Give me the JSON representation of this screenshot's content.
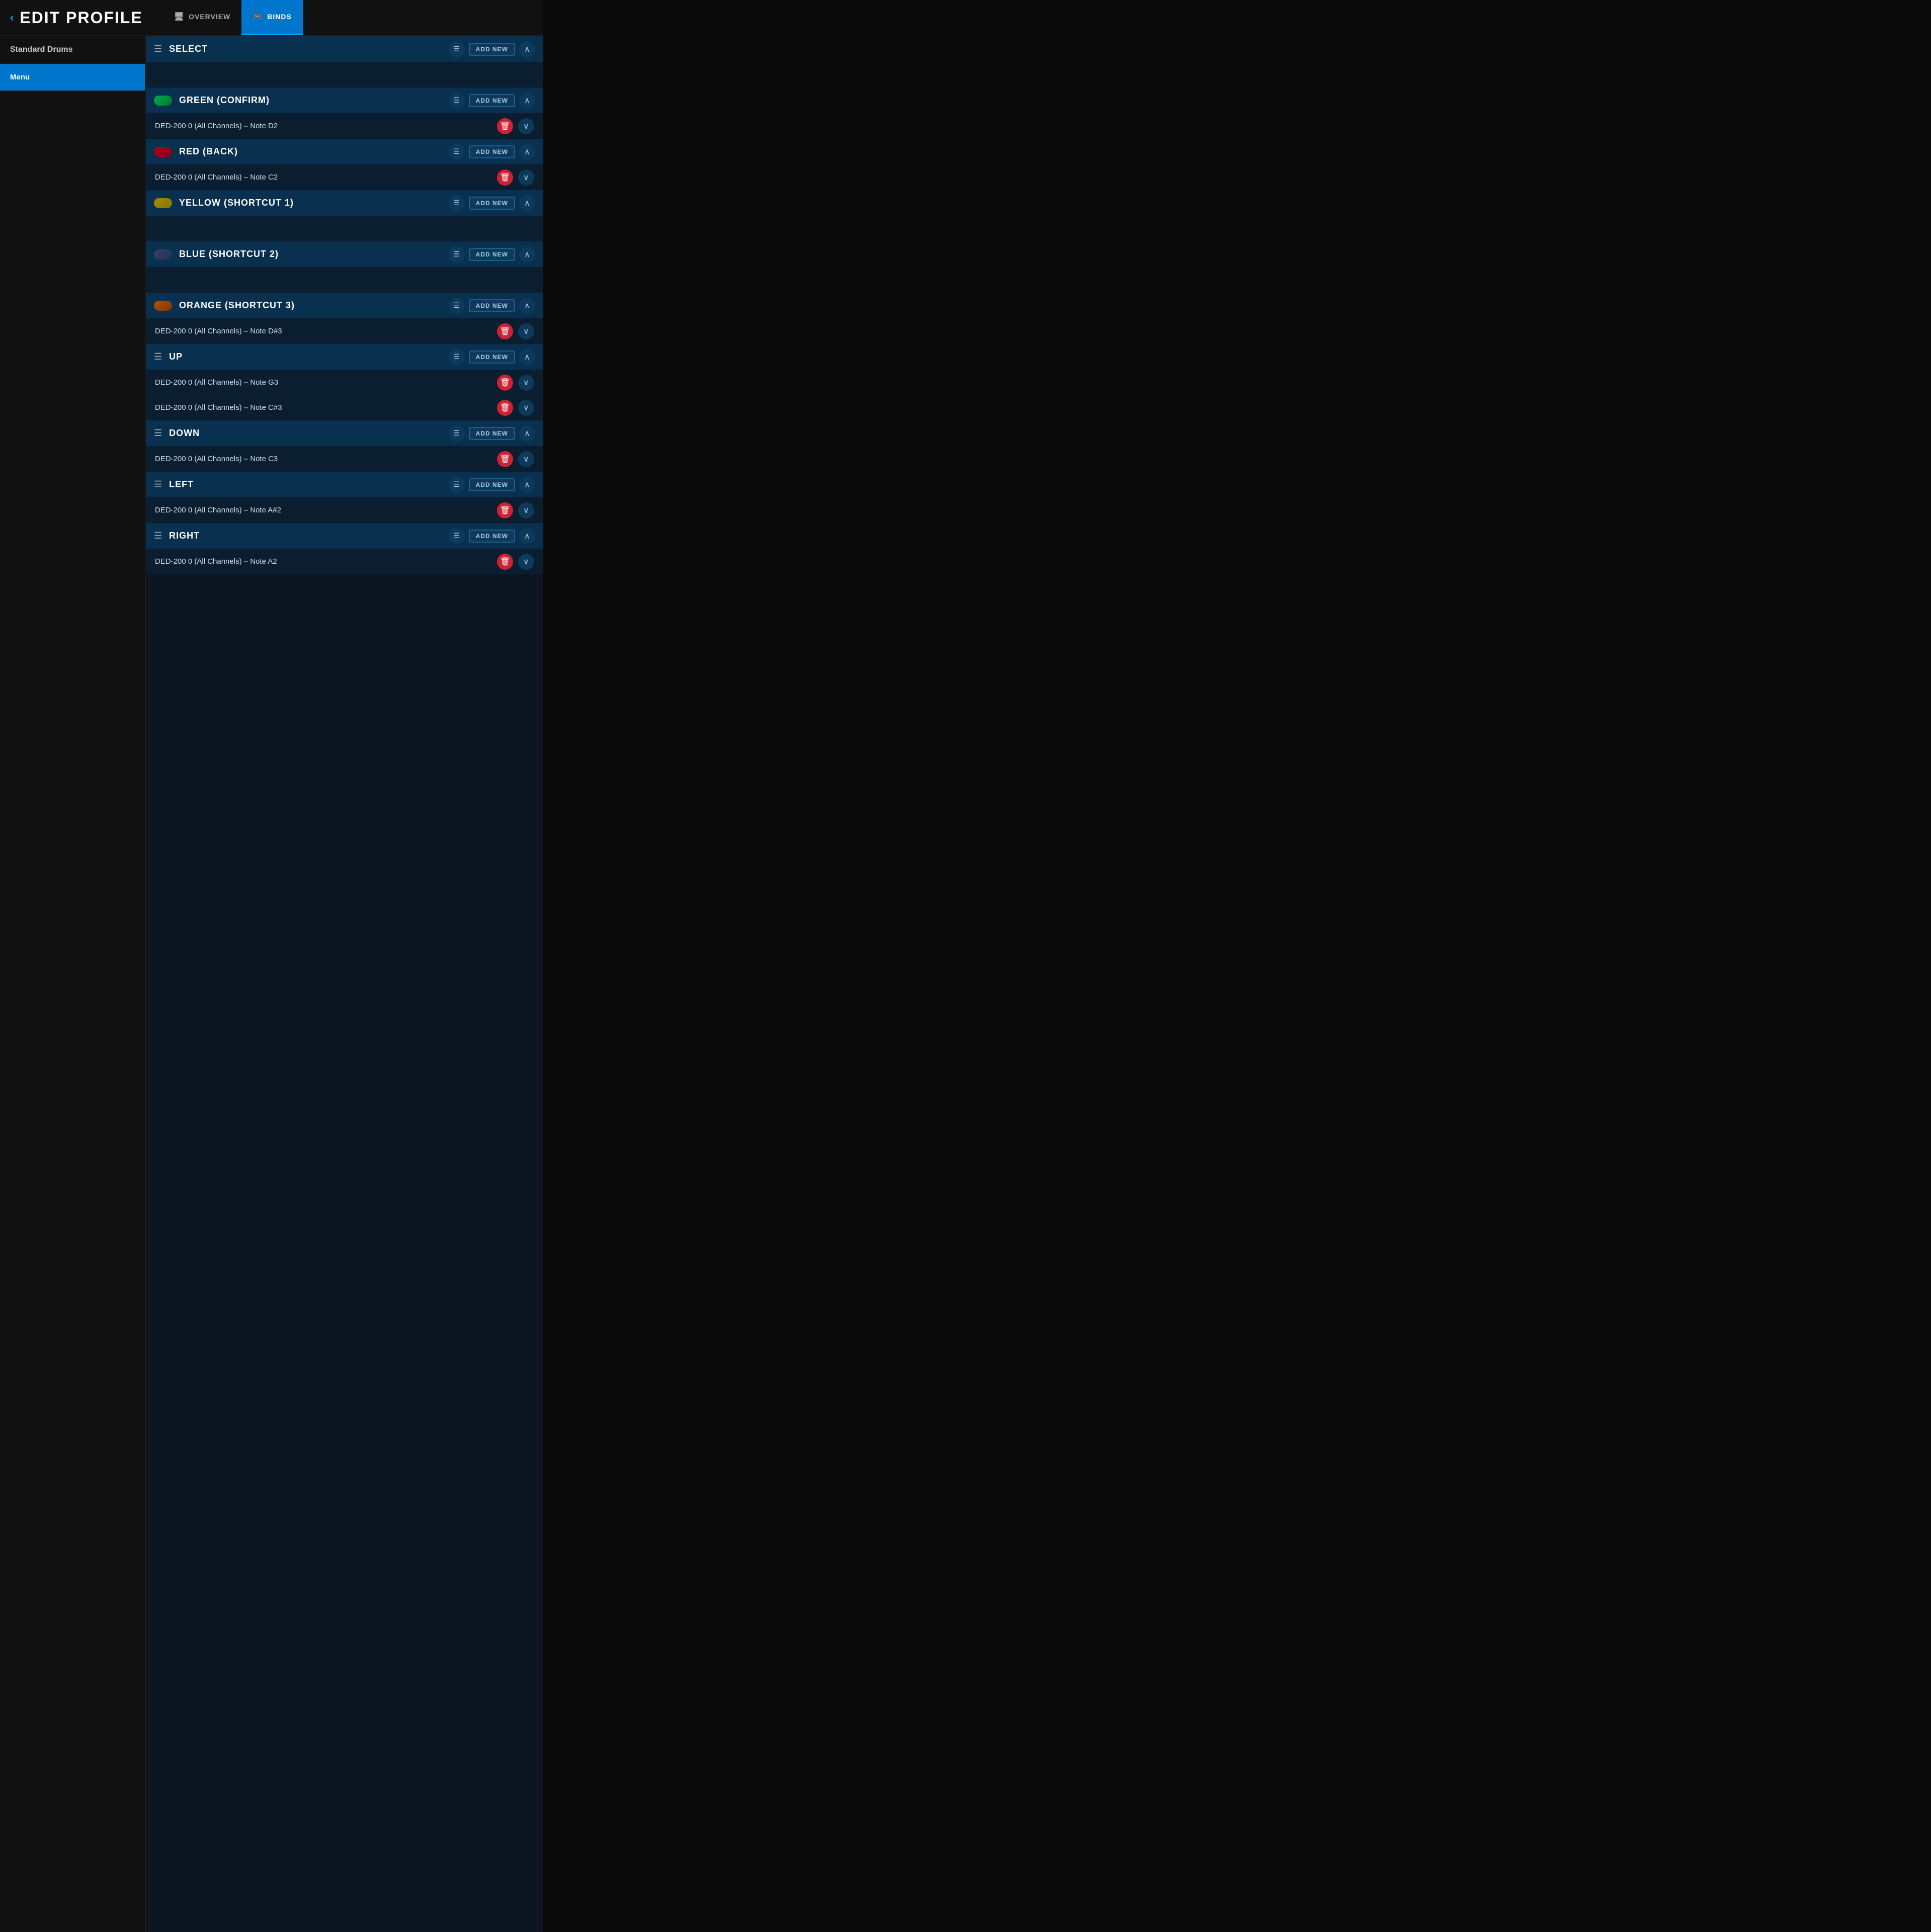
{
  "header": {
    "back_label": "‹",
    "title": "EDIT PROFILE",
    "tabs": [
      {
        "id": "overview",
        "label": "OVERVIEW",
        "icon": "🖥"
      },
      {
        "id": "binds",
        "label": "BINDS",
        "icon": "🎮",
        "active": true
      }
    ]
  },
  "sidebar": {
    "items": [
      {
        "id": "standard-drums",
        "label": "Standard Drums",
        "active": false
      },
      {
        "id": "menu",
        "label": "Menu",
        "active": true
      }
    ]
  },
  "sections": [
    {
      "id": "select",
      "title": "SELECT",
      "has_toggle": false,
      "toggle_class": "",
      "add_new_label": "ADD NEW",
      "binds": []
    },
    {
      "id": "green-confirm",
      "title": "GREEN (CONFIRM)",
      "has_toggle": true,
      "toggle_class": "toggle-green",
      "add_new_label": "ADD NEW",
      "binds": [
        {
          "label": "DED-200 0 (All Channels) – Note D2"
        }
      ]
    },
    {
      "id": "red-back",
      "title": "RED (BACK)",
      "has_toggle": true,
      "toggle_class": "toggle-red",
      "add_new_label": "ADD NEW",
      "binds": [
        {
          "label": "DED-200 0 (All Channels) – Note C2"
        }
      ]
    },
    {
      "id": "yellow-shortcut1",
      "title": "YELLOW (SHORTCUT 1)",
      "has_toggle": true,
      "toggle_class": "toggle-yellow",
      "add_new_label": "ADD NEW",
      "binds": []
    },
    {
      "id": "blue-shortcut2",
      "title": "BLUE (SHORTCUT 2)",
      "has_toggle": true,
      "toggle_class": "toggle-blue",
      "add_new_label": "ADD NEW",
      "binds": []
    },
    {
      "id": "orange-shortcut3",
      "title": "ORANGE (SHORTCUT 3)",
      "has_toggle": true,
      "toggle_class": "toggle-orange",
      "add_new_label": "ADD NEW",
      "binds": [
        {
          "label": "DED-200 0 (All Channels) – Note D#3"
        }
      ]
    },
    {
      "id": "up",
      "title": "UP",
      "has_toggle": false,
      "toggle_class": "",
      "add_new_label": "ADD NEW",
      "binds": [
        {
          "label": "DED-200 0 (All Channels) – Note G3"
        },
        {
          "label": "DED-200 0 (All Channels) – Note C#3"
        }
      ]
    },
    {
      "id": "down",
      "title": "DOWN",
      "has_toggle": false,
      "toggle_class": "",
      "add_new_label": "ADD NEW",
      "binds": [
        {
          "label": "DED-200 0 (All Channels) – Note C3"
        }
      ]
    },
    {
      "id": "left",
      "title": "LEFT",
      "has_toggle": false,
      "toggle_class": "",
      "add_new_label": "ADD NEW",
      "binds": [
        {
          "label": "DED-200 0 (All Channels) – Note A#2"
        }
      ]
    },
    {
      "id": "right",
      "title": "RIGHT",
      "has_toggle": false,
      "toggle_class": "",
      "add_new_label": "ADD NEW",
      "binds": [
        {
          "label": "DED-200 0 (All Channels) – Note A2"
        }
      ]
    }
  ],
  "icons": {
    "back": "‹",
    "chevron_up": "∧",
    "chevron_down": "∨",
    "delete": "🗑",
    "grid": "☰",
    "monitor": "🖥",
    "controller": "🎮"
  }
}
